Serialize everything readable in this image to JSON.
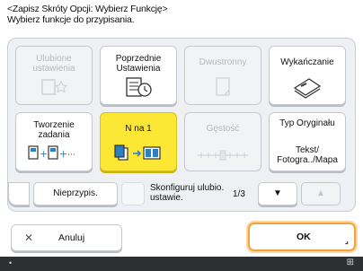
{
  "header": {
    "line1": "<Zapisz Skróty Opcji: Wybierz Funkcję>",
    "line2": "Wybierz funkcje do przypisania."
  },
  "buttons": {
    "b1": {
      "label": "Ulubione ustawienia",
      "icon": "star-list-icon"
    },
    "b2": {
      "label": "Poprzednie Ustawienia",
      "icon": "previous-settings-icon"
    },
    "b3": {
      "label": "Dwustronny",
      "icon": "duplex-icon"
    },
    "b4": {
      "label": "Wykańczanie",
      "icon": "finishing-icon"
    },
    "b5": {
      "label": "Tworzenie zadania",
      "icon": "job-build-icon"
    },
    "b6": {
      "label": "N na 1",
      "icon": "n-on-1-icon"
    },
    "b7": {
      "label": "Gęstość",
      "icon": "density-slider-icon"
    },
    "b8": {
      "label": "Typ Oryginału",
      "sub": "Tekst/ Fotogra../Mapa"
    }
  },
  "pager": {
    "unassign_label": "Nieprzypis.",
    "configure_label": "Skonfiguruj ulubio. ustawie.",
    "page": "1/3"
  },
  "footer": {
    "cancel_label": "Anuluj",
    "ok_label": "OK"
  },
  "colors": {
    "selected": "#fbe734",
    "ok_border": "#f4a23c",
    "statusbar": "#2d2f33"
  }
}
